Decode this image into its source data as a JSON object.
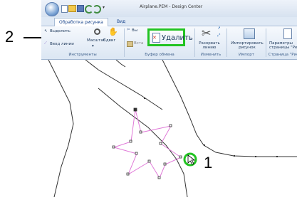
{
  "window": {
    "title": "Airplane.PEM - Design Center"
  },
  "tabs": [
    {
      "label": "Обработка рисунка",
      "active": true
    },
    {
      "label": "Вид",
      "active": false
    }
  ],
  "ribbon": {
    "select_label": "Выделить",
    "line_input_label": "Ввод линии",
    "scale_label": "Масштаб",
    "shift_label": "Сдвиг",
    "cut_label": "Вы",
    "delete_label": "Удалить",
    "insert_label": "Вста",
    "split_line_label": "Разорвать линию",
    "import_label": "Импортировать рисунок",
    "page_params_label": "Параметры страницы \"Ре",
    "groups": {
      "tools": "Инструменты",
      "clipboard": "Буфер обмена",
      "edit": "Изменить",
      "import": "Импорт",
      "page": "Страница \"Рис"
    }
  },
  "callouts": {
    "one": "1",
    "two": "2"
  },
  "colors": {
    "highlight": "#22c322",
    "star_outline": "#e07ad8",
    "line": "#333333"
  }
}
